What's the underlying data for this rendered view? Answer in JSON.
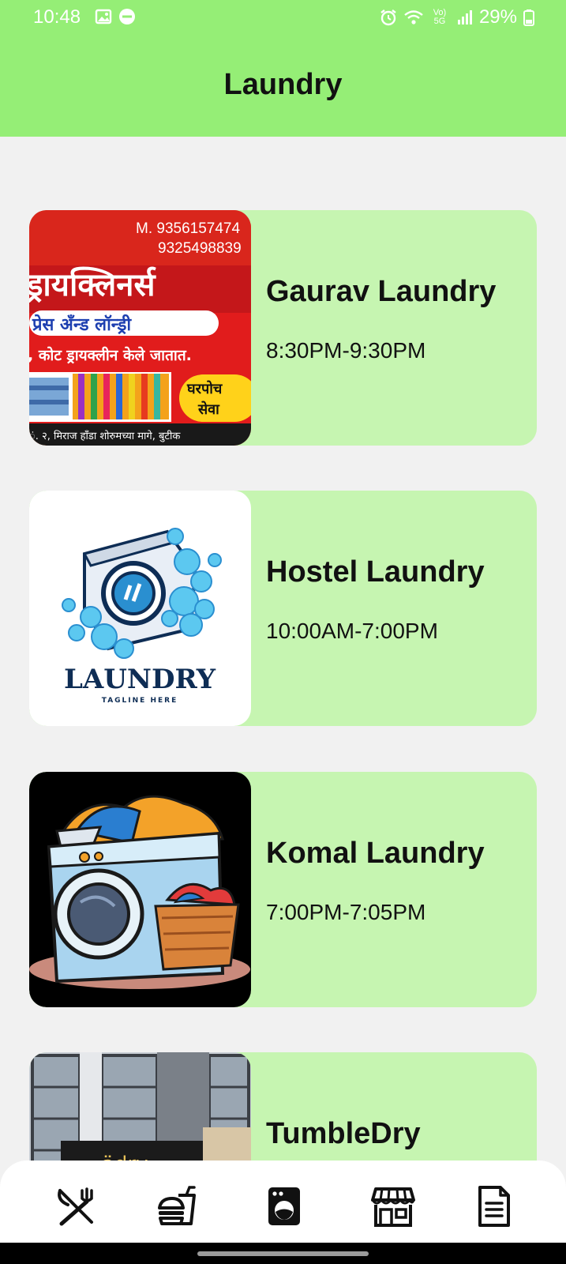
{
  "status_bar": {
    "time": "10:48",
    "battery": "29%",
    "network": "Vo) 5G"
  },
  "header": {
    "title": "Laundry",
    "background": "#95ee76"
  },
  "shops": [
    {
      "name": "Gaurav Laundry",
      "hours": "8:30PM-9:30PM",
      "banner": {
        "phone1": "M. 9356157474",
        "phone2": "9325498839",
        "headline": "ड्रायक्लिनर्स",
        "subline": "प्रेस अँन्ड लॉन्ड्री",
        "tagline": ", कोट ड्रायक्लीन केले जातात.",
        "badge_line1": "घरपोच",
        "badge_line2": "सेवा",
        "address": "ं. २, मिराज हॉंडा शोरुमच्या मागे, बुटीक"
      }
    },
    {
      "name": "Hostel Laundry",
      "hours": "10:00AM-7:00PM",
      "logo": {
        "text": "LAUNDRY",
        "tagline": "TAGLINE HERE"
      }
    },
    {
      "name": "Komal Laundry",
      "hours": "7:00PM-7:05PM"
    },
    {
      "name": "TumbleDry",
      "hours": "",
      "sign_text": "ädry"
    }
  ],
  "bottom_nav": [
    {
      "icon": "restaurant-icon"
    },
    {
      "icon": "fast-food-icon"
    },
    {
      "icon": "laundry-icon"
    },
    {
      "icon": "store-icon"
    },
    {
      "icon": "document-icon"
    }
  ],
  "colors": {
    "card_background": "#c6f5b1",
    "page_background": "#f1f1f1"
  }
}
